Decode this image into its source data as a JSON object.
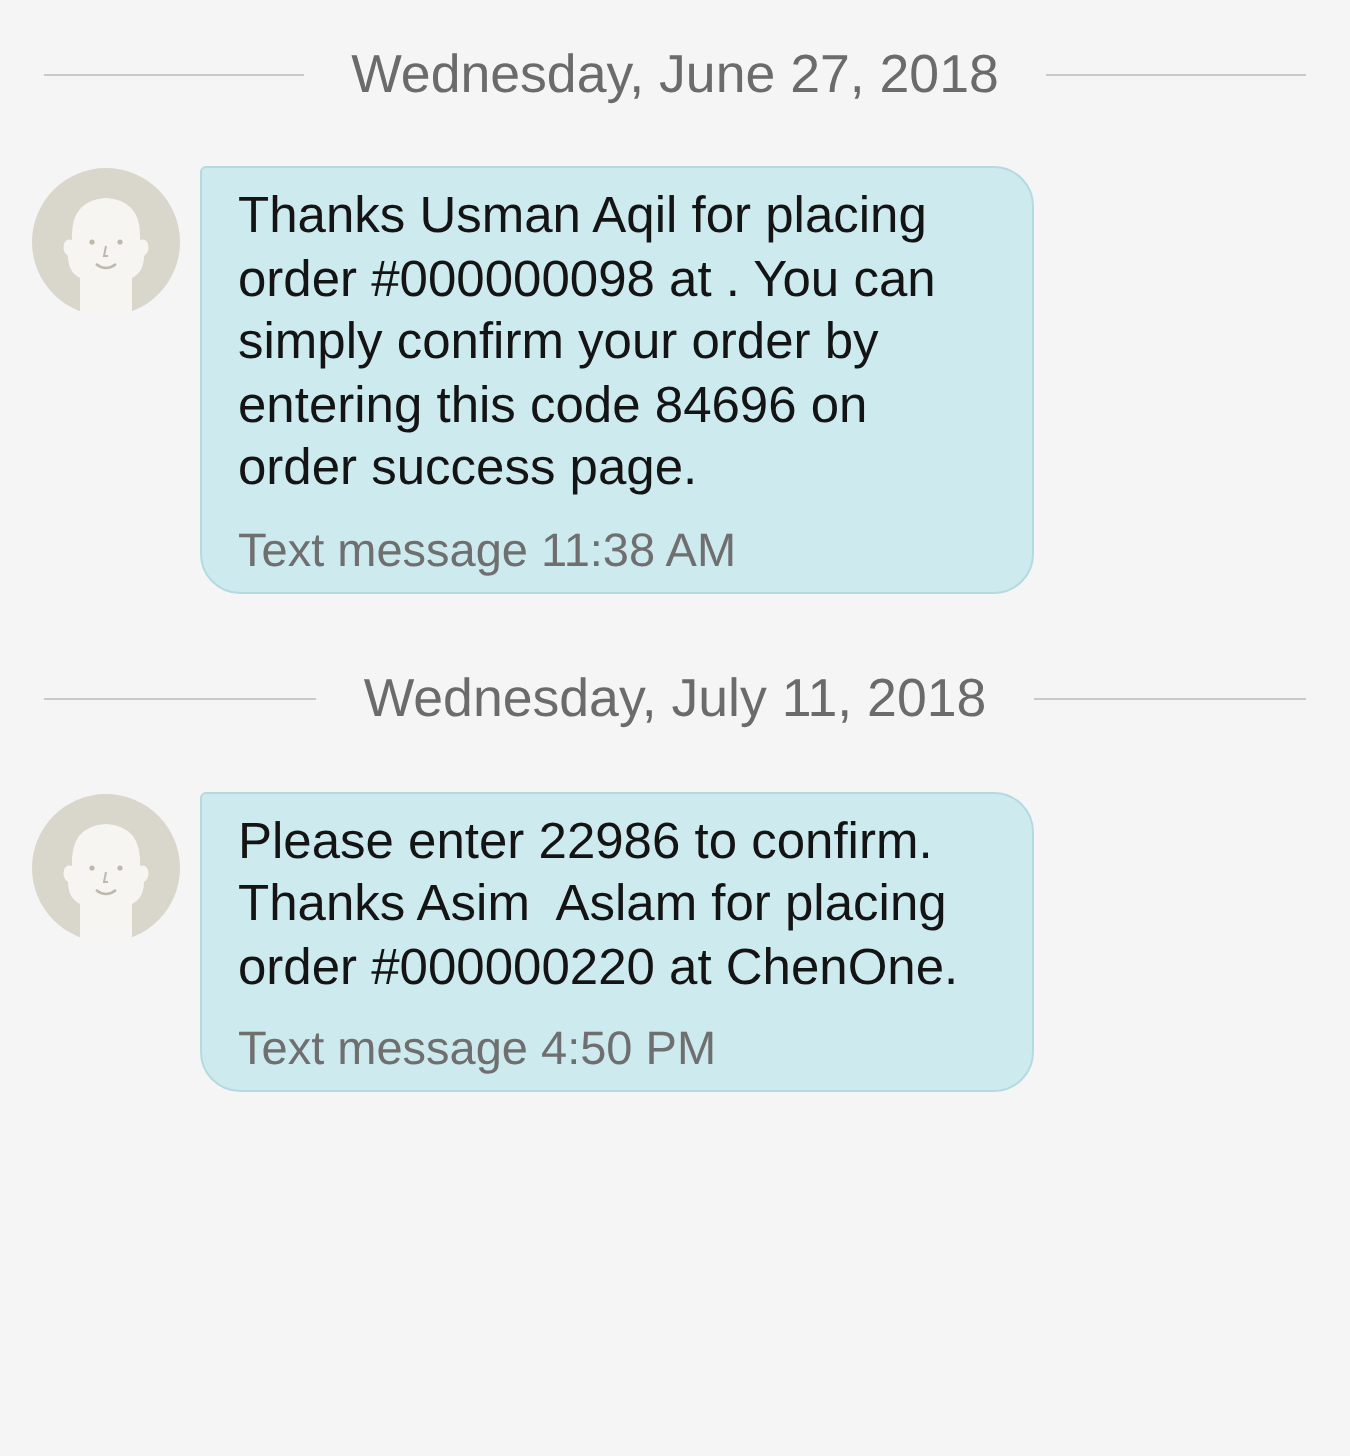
{
  "conversation": [
    {
      "date": "Wednesday, June 27, 2018",
      "messages": [
        {
          "text": "Thanks Usman Aqil for placing order #000000098 at . You can simply confirm your order by entering this code 84696 on order success page.",
          "meta": "Text message 11:38 AM"
        }
      ]
    },
    {
      "date": "Wednesday, July 11, 2018",
      "messages": [
        {
          "text": "Please enter 22986 to confirm. Thanks Asim  Aslam for placing order #000000220 at ChenOne.",
          "meta": "Text message 4:50 PM"
        }
      ]
    }
  ]
}
